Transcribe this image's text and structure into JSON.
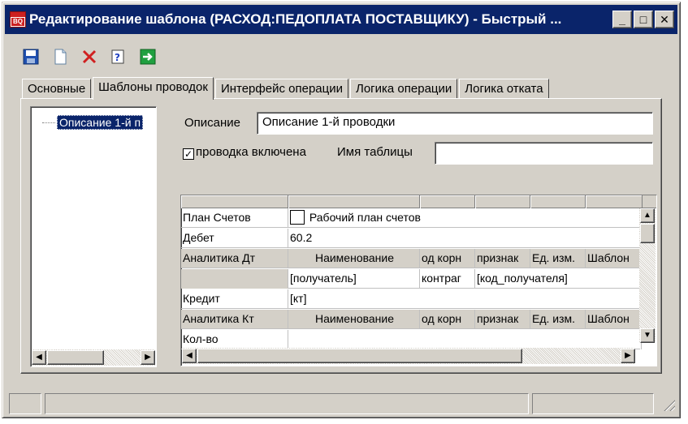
{
  "window": {
    "title": "Редактирование шаблона (РАСХОД:ПЕДОПЛАТА ПОСТАВЩИКУ) - Быстрый ...",
    "minimize": "_",
    "maximize": "□",
    "close": "✕"
  },
  "toolbar": {
    "icons": [
      "save-icon",
      "new-document-icon",
      "delete-icon",
      "help-icon",
      "exit-icon"
    ]
  },
  "tabs": [
    "Основные",
    "Шаблоны проводок",
    "Интерфейс операции",
    "Логика операции",
    "Логика отката"
  ],
  "active_tab": "Шаблоны проводок",
  "tree": {
    "item": "Описание 1-й п"
  },
  "form": {
    "description_label": "Описание",
    "description_value": "Описание 1-й проводки",
    "enabled_label": "проводка включена",
    "enabled_checked": true,
    "table_name_label": "Имя таблицы",
    "table_name_value": ""
  },
  "grid": {
    "rows": [
      {
        "label": "План Счетов",
        "value": "Рабочий план счетов",
        "has_box": true
      },
      {
        "label": "Дебет",
        "value": "60.2"
      },
      {
        "label": "Аналитика Дт",
        "header": true,
        "cols": [
          "Наименование",
          "од корн",
          "признак",
          "Ед. изм.",
          "Шаблон"
        ]
      },
      {
        "label": "",
        "cols": [
          "[получатель]",
          "контраг",
          "[код_получателя]"
        ]
      },
      {
        "label": "Кредит",
        "value": "[кт]"
      },
      {
        "label": "Аналитика Кт",
        "header": true,
        "cols": [
          "Наименование",
          "од корн",
          "признак",
          "Ед. изм.",
          "Шаблон"
        ]
      },
      {
        "label": "Кол-во",
        "value": ""
      }
    ]
  },
  "colors": {
    "titlebar": "#0a246a",
    "face": "#d4d0c8",
    "selection": "#0a246a"
  }
}
